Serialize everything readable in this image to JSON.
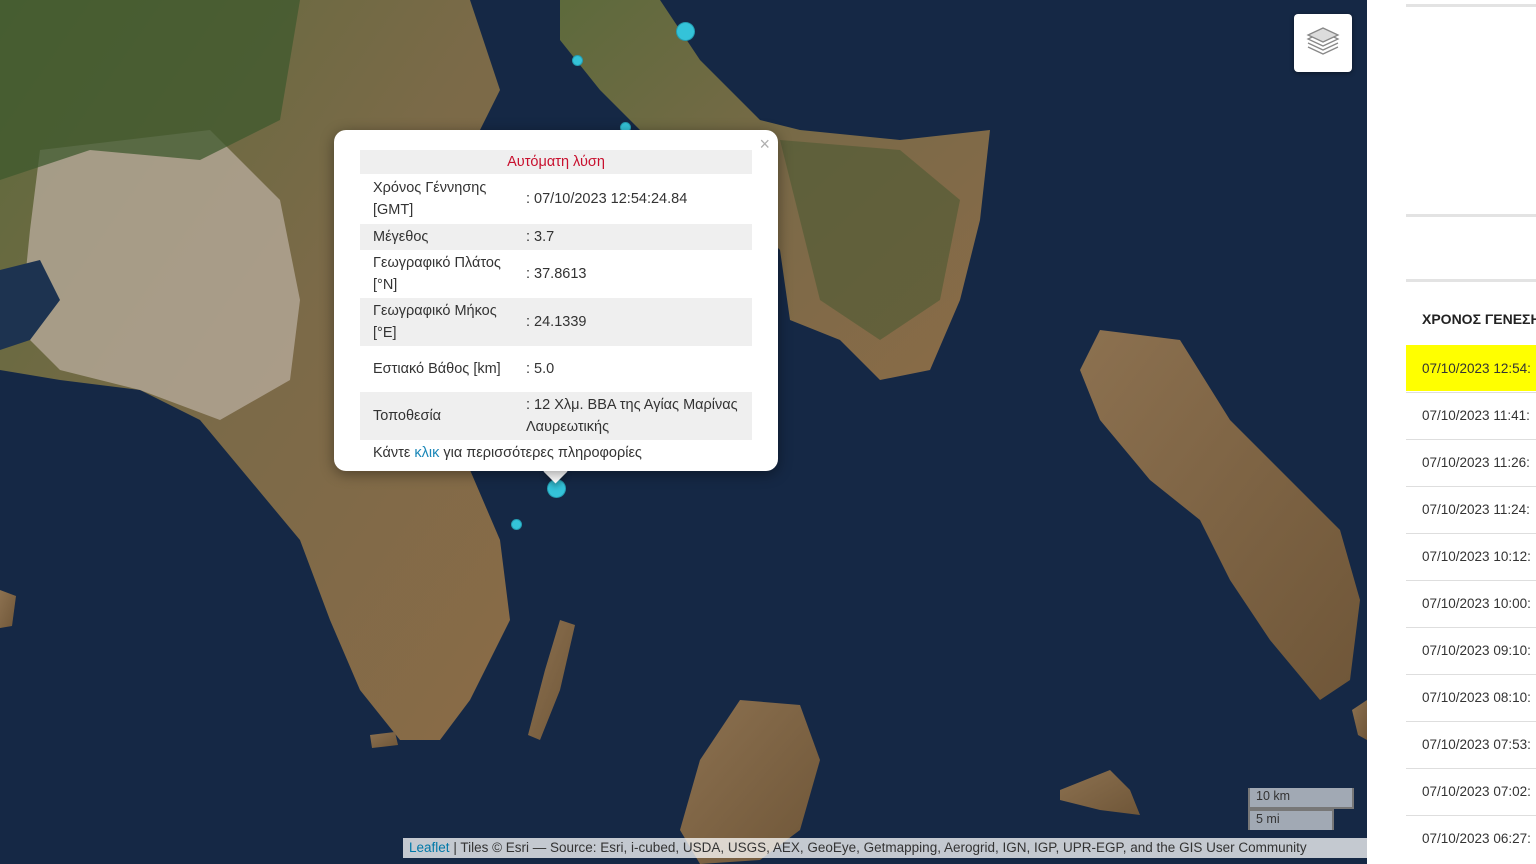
{
  "popup": {
    "header": "Αυτόματη λύση",
    "rows": [
      {
        "label": "Χρόνος Γέννησης [GMT]",
        "value": ": 07/10/2023 12:54:24.84"
      },
      {
        "label": "Μέγεθος",
        "value": ": 3.7"
      },
      {
        "label": "Γεωγραφικό Πλάτος [°N]",
        "value": ": 37.8613"
      },
      {
        "label": "Γεωγραφικό Μήκος [°E]",
        "value": ": 24.1339"
      },
      {
        "label": "Εστιακό Βάθος [km]",
        "value": ": 5.0"
      },
      {
        "label": "Τοποθεσία",
        "value": ": 12 Χλμ. ΒΒΑ της Αγίας Μαρίνας Λαυρεωτικής"
      }
    ],
    "footer_before": "Κάντε",
    "footer_link": "κλικ",
    "footer_after": "για περισσότερες πληροφορίες",
    "close_glyph": "×"
  },
  "scale": {
    "km": "10 km",
    "mi": "5 mi"
  },
  "attribution": {
    "link": "Leaflet",
    "text": "| Tiles © Esri — Source: Esri, i-cubed, USDA, USGS, AEX, GeoEye, Getmapping, Aerogrid, IGN, IGP, UPR-EGP, and the GIS User Community"
  },
  "panel": {
    "column_header": "ΧΡΟΝΟΣ ΓΕΝΕΣΗ",
    "times": [
      "07/10/2023 12:54:",
      "07/10/2023 11:41:",
      "07/10/2023 11:26:",
      "07/10/2023 11:24:",
      "07/10/2023 10:12:",
      "07/10/2023 10:00:",
      "07/10/2023 09:10:",
      "07/10/2023 08:10:",
      "07/10/2023 07:53:",
      "07/10/2023 07:02:",
      "07/10/2023 06:27:"
    ],
    "highlight_color": "#ffff00"
  },
  "icons": {
    "layers": "layers-icon",
    "close": "close-icon"
  },
  "colors": {
    "sea": "#152845",
    "marker": "#34c3d9",
    "popup_header": "#c8102e",
    "link": "#1a87b8"
  }
}
